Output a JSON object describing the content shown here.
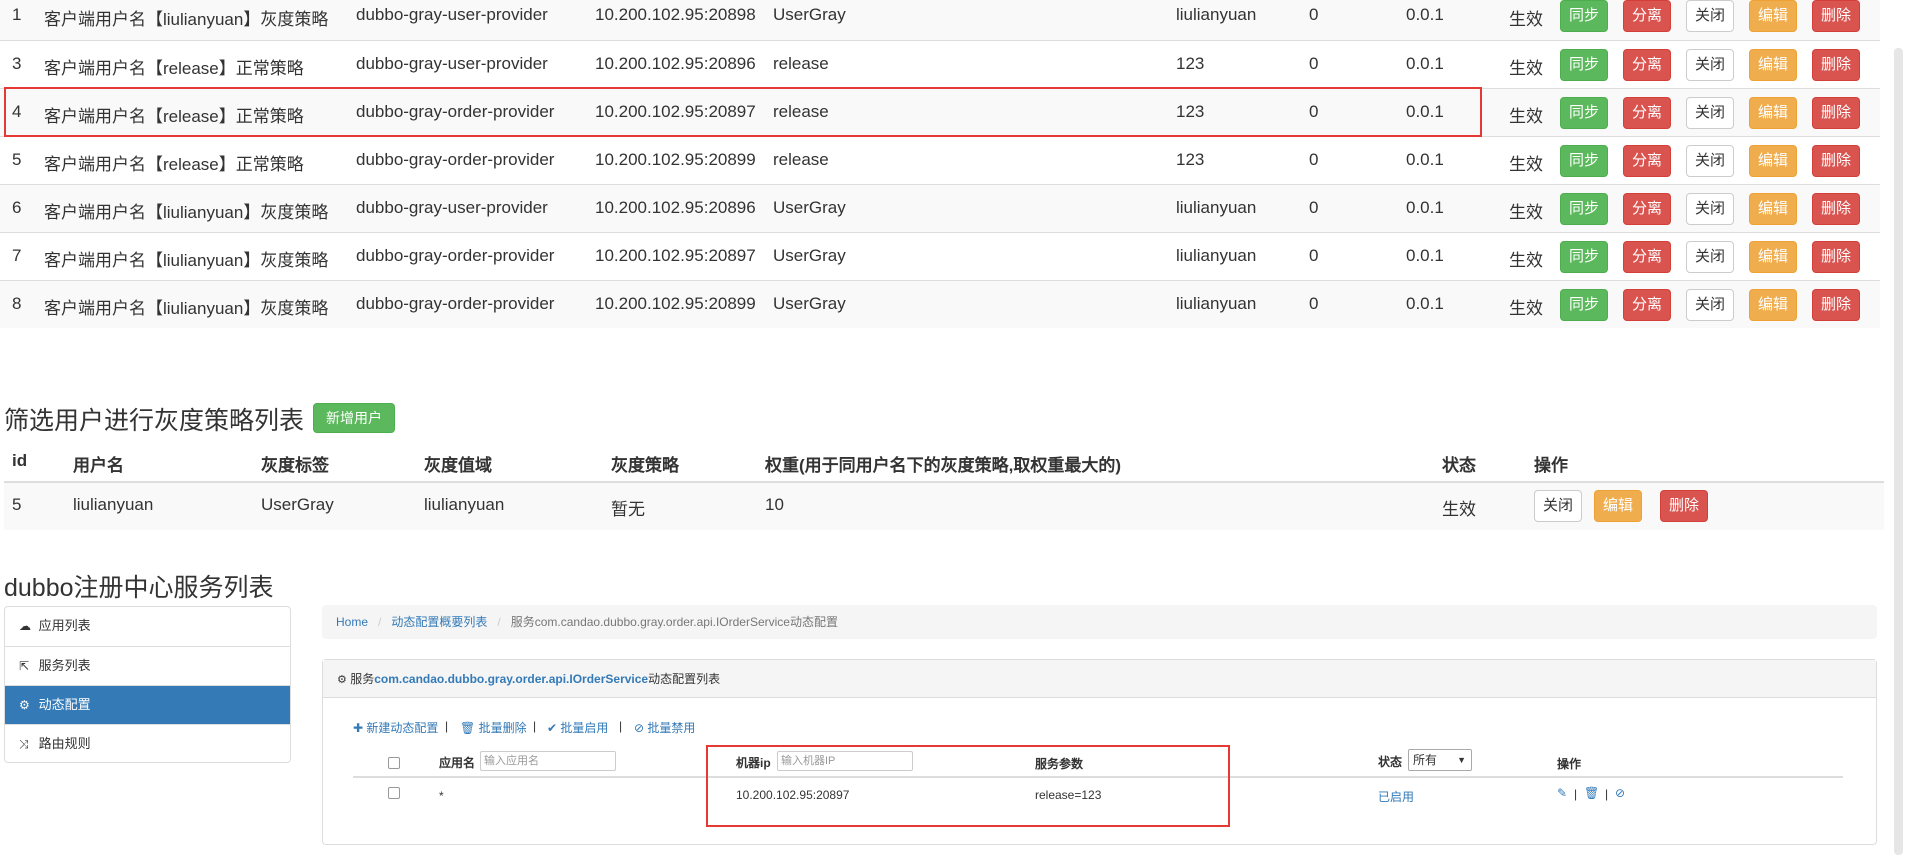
{
  "strategy_rows": [
    {
      "idx": "1",
      "name": "客户端用户名【liulianyuan】灰度策略",
      "provider": "dubbo-gray-user-provider",
      "address": "10.200.102.95:20898",
      "tag": "UserGray",
      "value": "liulianyuan",
      "zero": "0",
      "version": "0.0.1",
      "status": "生效"
    },
    {
      "idx": "3",
      "name": "客户端用户名【release】正常策略",
      "provider": "dubbo-gray-user-provider",
      "address": "10.200.102.95:20896",
      "tag": "release",
      "value": "123",
      "zero": "0",
      "version": "0.0.1",
      "status": "生效"
    },
    {
      "idx": "4",
      "name": "客户端用户名【release】正常策略",
      "provider": "dubbo-gray-order-provider",
      "address": "10.200.102.95:20897",
      "tag": "release",
      "value": "123",
      "zero": "0",
      "version": "0.0.1",
      "status": "生效"
    },
    {
      "idx": "5",
      "name": "客户端用户名【release】正常策略",
      "provider": "dubbo-gray-order-provider",
      "address": "10.200.102.95:20899",
      "tag": "release",
      "value": "123",
      "zero": "0",
      "version": "0.0.1",
      "status": "生效"
    },
    {
      "idx": "6",
      "name": "客户端用户名【liulianyuan】灰度策略",
      "provider": "dubbo-gray-user-provider",
      "address": "10.200.102.95:20896",
      "tag": "UserGray",
      "value": "liulianyuan",
      "zero": "0",
      "version": "0.0.1",
      "status": "生效"
    },
    {
      "idx": "7",
      "name": "客户端用户名【liulianyuan】灰度策略",
      "provider": "dubbo-gray-order-provider",
      "address": "10.200.102.95:20897",
      "tag": "UserGray",
      "value": "liulianyuan",
      "zero": "0",
      "version": "0.0.1",
      "status": "生效"
    },
    {
      "idx": "8",
      "name": "客户端用户名【liulianyuan】灰度策略",
      "provider": "dubbo-gray-order-provider",
      "address": "10.200.102.95:20899",
      "tag": "UserGray",
      "value": "liulianyuan",
      "zero": "0",
      "version": "0.0.1",
      "status": "生效"
    }
  ],
  "row_buttons": {
    "sync": "同步",
    "split": "分离",
    "close": "关闭",
    "edit": "编辑",
    "delete": "删除"
  },
  "user_section": {
    "title": "筛选用户进行灰度策略列表",
    "add_button": "新增用户",
    "headers": {
      "id": "id",
      "username": "用户名",
      "gray_tag": "灰度标签",
      "gray_domain": "灰度值域",
      "gray_strategy": "灰度策略",
      "weight": "权重(用于同用户名下的灰度策略,取权重最大的)",
      "status": "状态",
      "action": "操作"
    },
    "rows": [
      {
        "id": "5",
        "username": "liulianyuan",
        "gray_tag": "UserGray",
        "gray_domain": "liulianyuan",
        "gray_strategy": "暂无",
        "weight": "10",
        "status": "生效"
      }
    ]
  },
  "dubbo": {
    "title": "dubbo注册中心服务列表",
    "sidebar": {
      "items": [
        {
          "icon": "cloud-icon",
          "glyph": "☁",
          "label": "应用列表"
        },
        {
          "icon": "share-icon",
          "glyph": "⇱",
          "label": "服务列表"
        },
        {
          "icon": "gears-icon",
          "glyph": "⚙",
          "label": "动态配置"
        },
        {
          "icon": "random-icon",
          "glyph": "⤨",
          "label": "路由规则"
        }
      ]
    },
    "breadcrumb": {
      "home": "Home",
      "list": "动态配置概要列表",
      "current": "服务com.candao.dubbo.gray.order.api.IOrderService动态配置"
    },
    "panel": {
      "head_prefix": "服务",
      "head_service": "com.candao.dubbo.gray.order.api.IOrderService",
      "head_suffix": "动态配置列表",
      "toolbar": {
        "new": "新建动态配置",
        "batch_delete": "批量删除",
        "batch_enable": "批量启用",
        "batch_disable": "批量禁用"
      },
      "columns": {
        "app": "应用名",
        "app_placeholder": "输入应用名",
        "ip": "机器ip",
        "ip_placeholder": "输入机器IP",
        "params": "服务参数",
        "status": "状态",
        "status_select": "所有",
        "action": "操作"
      },
      "row": {
        "app": "*",
        "ip": "10.200.102.95:20897",
        "params": "release=123",
        "status": "已启用"
      }
    }
  },
  "colors": {
    "green": "#5cb85c",
    "red": "#d9534f",
    "orange": "#f0ad4e",
    "blue": "#337ab7",
    "highlight": "#e53935"
  }
}
